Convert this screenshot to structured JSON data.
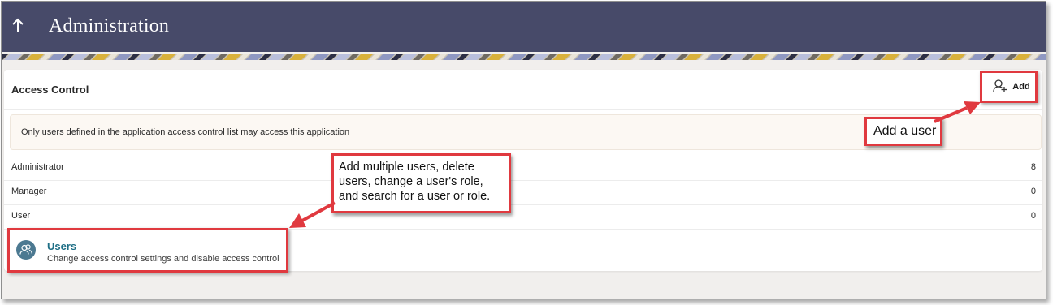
{
  "header": {
    "title": "Administration",
    "background": "#474a69",
    "back_icon": "arrow-up-icon"
  },
  "access_control": {
    "title": "Access Control",
    "add_button": {
      "label": "Add",
      "icon": "add-user-icon"
    },
    "notice": "Only users defined in the application access control list may access this application",
    "roles": [
      {
        "name": "Administrator",
        "count": "8"
      },
      {
        "name": "Manager",
        "count": "0"
      },
      {
        "name": "User",
        "count": "0"
      }
    ],
    "users_link": {
      "title": "Users",
      "subtitle": "Change access control settings and disable access control",
      "icon": "users-icon"
    }
  },
  "annotations": {
    "add_user": "Add a user",
    "multi_lines": [
      "Add multiple users, delete",
      "users, change a user's role,",
      "and search for a user or role."
    ],
    "color": "#e0393f"
  }
}
